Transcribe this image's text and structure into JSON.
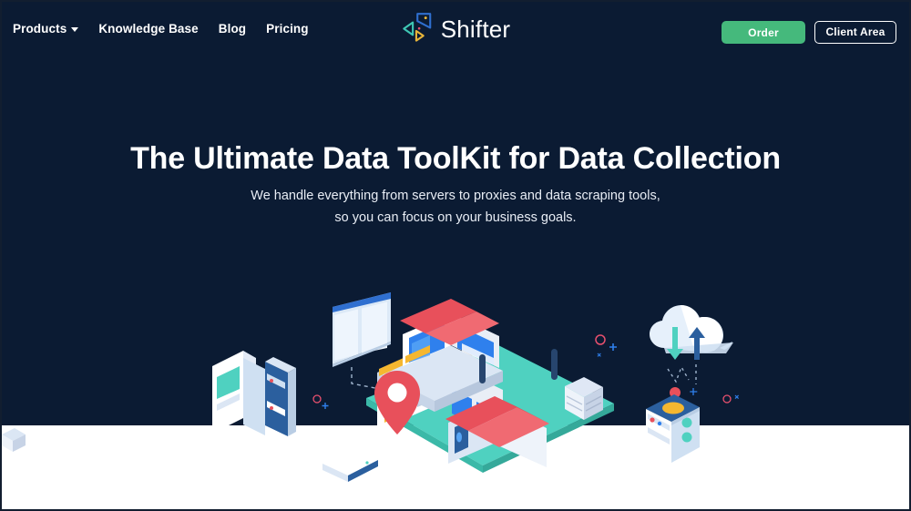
{
  "brand": {
    "name": "Shifter",
    "logo_icon": "shifter-chevrons-logo",
    "logo_colors": {
      "teal": "#3ec7b4",
      "blue": "#2f6fd0",
      "gold": "#e8b53a",
      "accent_dot_gold": "#e8b53a",
      "accent_dot_pink": "#e8506e"
    }
  },
  "nav": {
    "items": [
      {
        "label": "Products",
        "has_dropdown": true,
        "icon": "chevron-down-icon"
      },
      {
        "label": "Knowledge Base",
        "has_dropdown": false
      },
      {
        "label": "Blog",
        "has_dropdown": false
      },
      {
        "label": "Pricing",
        "has_dropdown": false
      }
    ],
    "order_label": "Order",
    "client_area_label": "Client Area"
  },
  "hero": {
    "title": "The Ultimate Data ToolKit for Data Collection",
    "subtitle_line_1": "We handle everything from servers to proxies and data scraping tools,",
    "subtitle_line_2": "so you can focus on your business goals."
  },
  "colors": {
    "background_dark": "#0b1b33",
    "background_light": "#ffffff",
    "accent_green": "#45b97c",
    "accent_red": "#e8505b",
    "accent_teal": "#4fd1c0",
    "accent_blue": "#2f80ed",
    "accent_yellow": "#f5b730",
    "text_primary": "#ffffff",
    "text_secondary": "#e8edf5"
  },
  "illustration": {
    "name": "isometric-data-infrastructure-scene",
    "elements": [
      "server-kiosk",
      "browser-window-panel",
      "map-pin-marker",
      "isometric-building-red-roof",
      "isometric-house-red-roof",
      "teal-platform",
      "file-storage-boxes",
      "wifi-router",
      "cloud-sync",
      "server-box-with-dish",
      "sparkle-decorations"
    ]
  }
}
